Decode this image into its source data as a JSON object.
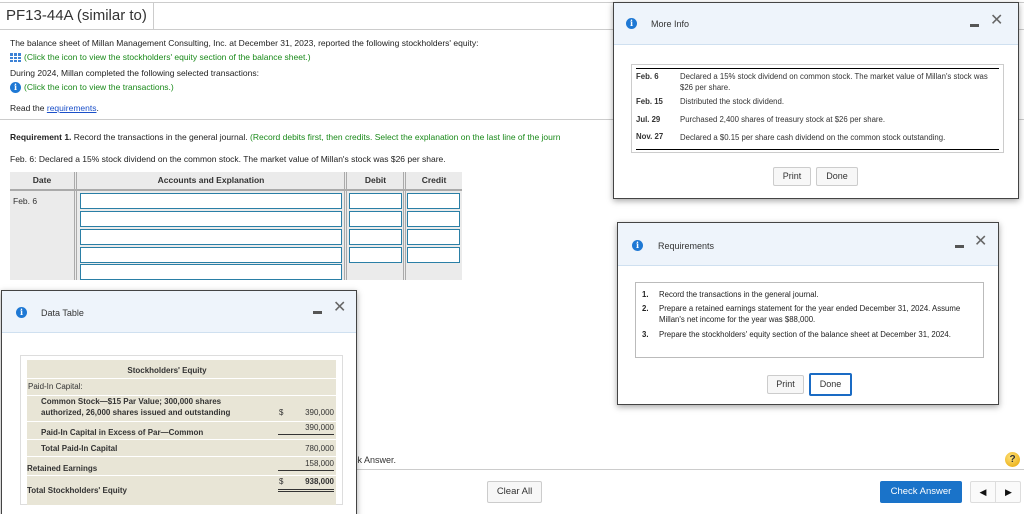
{
  "header": {
    "title": "PF13-44A (similar to)"
  },
  "problem": {
    "intro": "The balance sheet of Millan Management Consulting, Inc. at December 31, 2023, reported the following stockholders' equity:",
    "equity_link": "(Click the icon to view the stockholders' equity section of the balance sheet.)",
    "during": "During 2024, Millan completed the following selected transactions:",
    "transactions_link": "(Click the icon to view the transactions.)",
    "read_prefix": "Read the ",
    "read_link": "requirements",
    "read_suffix": ".",
    "requirement_label": "Requirement 1.",
    "requirement_text": " Record the transactions in the general journal. ",
    "requirement_hint": "(Record debits first, then credits. Select the explanation on the last line of the journ",
    "transaction_prompt": "Feb. 6: Declared a 15% stock dividend on the common stock. The market value of Millan's stock was $26 per share."
  },
  "journal": {
    "headers": {
      "date": "Date",
      "accounts": "Accounts and Explanation",
      "debit": "Debit",
      "credit": "Credit"
    },
    "date": "Feb. 6",
    "rows": [
      {
        "account": "",
        "debit": "",
        "credit": ""
      },
      {
        "account": "",
        "debit": "",
        "credit": ""
      },
      {
        "account": "",
        "debit": "",
        "credit": ""
      },
      {
        "account": "",
        "debit": "",
        "credit": ""
      },
      {
        "account": ""
      }
    ]
  },
  "more_info": {
    "title": "More Info",
    "items": [
      {
        "date": "Feb. 6",
        "text": "Declared a 15% stock dividend on common stock. The market value of Millan's stock was $26 per share."
      },
      {
        "date": "Feb. 15",
        "text": "Distributed the stock dividend."
      },
      {
        "date": "Jul. 29",
        "text": "Purchased 2,400 shares of treasury stock at $26 per share."
      },
      {
        "date": "Nov. 27",
        "text": "Declared a $0.15 per share cash dividend on the common stock outstanding."
      }
    ],
    "print": "Print",
    "done": "Done"
  },
  "requirements": {
    "title": "Requirements",
    "items": [
      {
        "num": "1.",
        "text": "Record the transactions in the general journal."
      },
      {
        "num": "2.",
        "text": "Prepare a retained earnings statement for the year ended December 31, 2024. Assume Millan's net income for the year was $88,000."
      },
      {
        "num": "3.",
        "text": "Prepare the stockholders' equity section of the balance sheet at December 31, 2024."
      }
    ],
    "print": "Print",
    "done": "Done"
  },
  "data_table": {
    "title": "Data Table",
    "heading": "Stockholders' Equity",
    "paid_in_label": "Paid-In Capital:",
    "common_stock_1": "Common Stock—$15 Par Value; 300,000 shares",
    "common_stock_2": "authorized, 26,000 shares issued and outstanding",
    "common_stock_currency": "$",
    "common_stock_value": "390,000",
    "excess_label": "Paid-In Capital in Excess of Par—Common",
    "excess_value": "390,000",
    "total_paid_label": "Total Paid-In Capital",
    "total_paid_value": "780,000",
    "retained_label": "Retained Earnings",
    "retained_value": "158,000",
    "total_label": "Total Stockholders' Equity",
    "total_currency": "$",
    "total_value": "938,000"
  },
  "footer": {
    "partial_text": "ck Answer.",
    "clear_all": "Clear All",
    "check_answer": "Check Answer",
    "help": "?",
    "prev": "◀",
    "next": "▶"
  }
}
